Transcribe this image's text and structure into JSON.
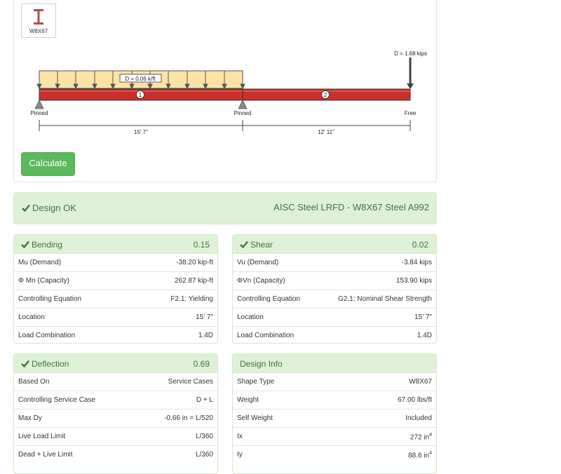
{
  "shape_label": "W8X67",
  "beam": {
    "load_label": "D = 0.06 k/ft",
    "point_load_label": "D = 1.68 kips",
    "span_numbers": [
      "1",
      "2"
    ],
    "supports": [
      "Pinned",
      "Pinned",
      "Free"
    ],
    "dimensions": [
      "15' 7\"",
      "12' 11\""
    ]
  },
  "calculate_label": "Calculate",
  "design": {
    "status": "Design OK",
    "spec": "AISC Steel LRFD - W8X67 Steel A992"
  },
  "bending": {
    "title": "Bending",
    "ratio": "0.15",
    "rows": [
      {
        "k": "Mu (Demand)",
        "v": "-38.20 kip-ft"
      },
      {
        "k": "Φ Mn (Capacity)",
        "v": "262.87 kip-ft"
      },
      {
        "k": "Controlling Equation",
        "v": "F2.1: Yielding"
      },
      {
        "k": "Location",
        "v": "15' 7\""
      },
      {
        "k": "Load Combination",
        "v": "1.4D"
      }
    ]
  },
  "shear": {
    "title": "Shear",
    "ratio": "0.02",
    "rows": [
      {
        "k": "Vu (Demand)",
        "v": "-3.84 kips"
      },
      {
        "k": "ΦVn (Capacity)",
        "v": "153.90 kips"
      },
      {
        "k": "Controlling Equation",
        "v": "G2.1: Nominal Shear Strength"
      },
      {
        "k": "Location",
        "v": "15' 7\""
      },
      {
        "k": "Load Combination",
        "v": "1.4D"
      }
    ]
  },
  "deflection": {
    "title": "Deflection",
    "ratio": "0.69",
    "rows": [
      {
        "k": "Based On",
        "v": "Service Cases"
      },
      {
        "k": "Controlling Service Case",
        "v": "D + L"
      },
      {
        "k": "Max Dy",
        "v": "-0.66 in = L/520"
      },
      {
        "k": "Live Load Limit",
        "v": "L/360"
      },
      {
        "k": "Dead + Live Limit",
        "v": "L/360"
      }
    ]
  },
  "info": {
    "title": "Design Info",
    "rows": [
      {
        "k": "Shape Type",
        "v": "W8X67"
      },
      {
        "k": "Weight",
        "v": "67.00 lbs/ft"
      },
      {
        "k": "Self Weight",
        "v": "Included"
      },
      {
        "k": "Ix",
        "v": "272 in",
        "sup": "4"
      },
      {
        "k": "Iy",
        "v": "88.6 in",
        "sup": "4"
      }
    ]
  },
  "colors": {
    "beam": "#c9302c",
    "load_fill": "#fbe3a5",
    "success_bg": "#dff0d8",
    "success_text": "#3c763d",
    "button": "#5cb85c"
  }
}
